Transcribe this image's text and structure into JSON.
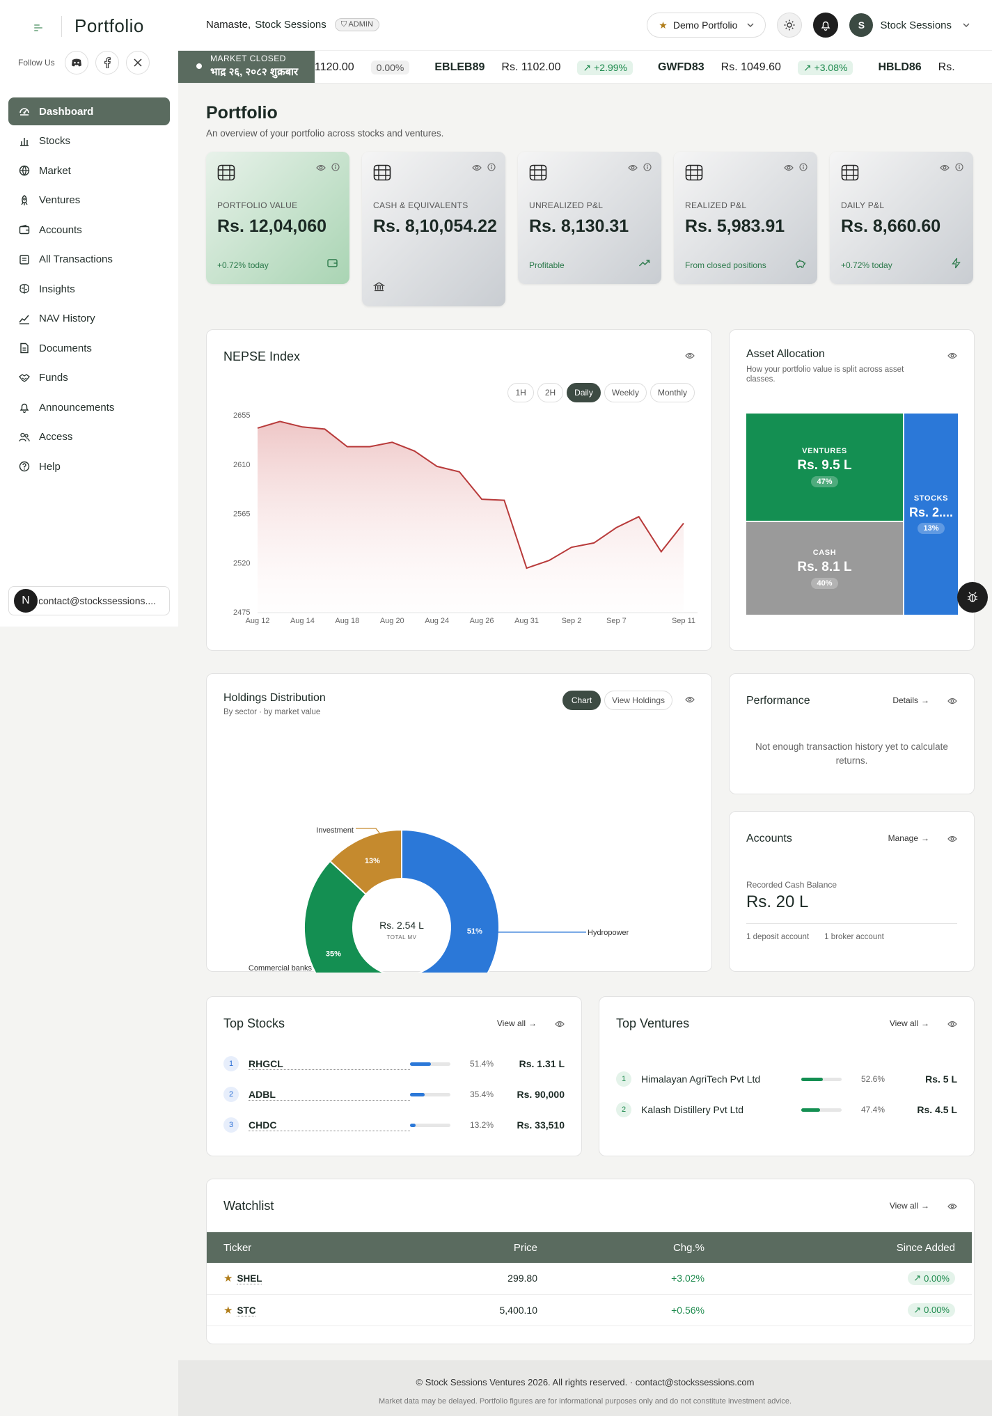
{
  "app": {
    "title": "Portfolio"
  },
  "sidebar": {
    "follow_label": "Follow Us",
    "items": [
      {
        "label": "Dashboard",
        "icon": "dashboard-icon"
      },
      {
        "label": "Stocks",
        "icon": "bar-chart-icon"
      },
      {
        "label": "Market",
        "icon": "globe-icon"
      },
      {
        "label": "Ventures",
        "icon": "rocket-icon"
      },
      {
        "label": "Accounts",
        "icon": "wallet-icon"
      },
      {
        "label": "All Transactions",
        "icon": "receipt-icon"
      },
      {
        "label": "Insights",
        "icon": "brain-icon"
      },
      {
        "label": "NAV History",
        "icon": "line-chart-icon"
      },
      {
        "label": "Documents",
        "icon": "document-icon"
      },
      {
        "label": "Funds",
        "icon": "handshake-icon"
      },
      {
        "label": "Announcements",
        "icon": "bell-icon"
      },
      {
        "label": "Access",
        "icon": "users-icon"
      },
      {
        "label": "Help",
        "icon": "help-icon"
      }
    ],
    "contact_email": "contact@stockssessions....",
    "avatar_letter": "N"
  },
  "topbar": {
    "greeting": "Namaste,",
    "username": "Stock Sessions",
    "role_badge": "ADMIN",
    "portfolio_selector": "Demo Portfolio",
    "user_initial": "S",
    "user_name": "Stock Sessions"
  },
  "ticker": {
    "market_status": "MARKET CLOSED",
    "date_np": "भाद्र २६, २०८२ शुक्रबार",
    "items": [
      {
        "symbol": "",
        "price": "1120.00",
        "change": "0.00%",
        "dir": "neutral"
      },
      {
        "symbol": "EBLEB89",
        "price": "Rs. 1102.00",
        "change": "+2.99%",
        "dir": "up"
      },
      {
        "symbol": "GWFD83",
        "price": "Rs. 1049.60",
        "change": "+3.08%",
        "dir": "up"
      },
      {
        "symbol": "HBLD86",
        "price": "Rs.",
        "change": "",
        "dir": "up"
      }
    ]
  },
  "page": {
    "title": "Portfolio",
    "subtitle": "An overview of your portfolio across stocks and ventures."
  },
  "kpis": [
    {
      "label": "PORTFOLIO VALUE",
      "value": "Rs. 12,04,060",
      "footer": "+0.72% today",
      "variant": "green",
      "icon": "wallet-icon"
    },
    {
      "label": "CASH & EQUIVALENTS",
      "value": "Rs. 8,10,054.22",
      "footer": "",
      "variant": "grey",
      "icon": "bank-icon"
    },
    {
      "label": "UNREALIZED P&L",
      "value": "Rs. 8,130.31",
      "footer": "Profitable",
      "variant": "grey",
      "icon": "trending-up-icon"
    },
    {
      "label": "REALIZED P&L",
      "value": "Rs. 5,983.91",
      "footer": "From closed positions",
      "variant": "grey",
      "icon": "piggy-bank-icon"
    },
    {
      "label": "DAILY P&L",
      "value": "Rs. 8,660.60",
      "footer": "+0.72% today",
      "variant": "grey",
      "icon": "zap-icon"
    }
  ],
  "nepse": {
    "title": "NEPSE Index",
    "ranges": [
      "1H",
      "2H",
      "Daily",
      "Weekly",
      "Monthly"
    ],
    "active_range": "Daily"
  },
  "chart_data": [
    {
      "type": "area",
      "title": "NEPSE Index",
      "x": [
        "Aug 12",
        "Aug 13",
        "Aug 14",
        "Aug 15",
        "Aug 18",
        "Aug 19",
        "Aug 20",
        "Aug 21",
        "Aug 24",
        "Aug 25",
        "Aug 26",
        "Aug 27",
        "Aug 31",
        "Sep 1",
        "Sep 2",
        "Sep 3",
        "Sep 7",
        "Sep 8",
        "Sep 10",
        "Sep 11"
      ],
      "x_tick_labels": [
        "Aug 12",
        "Aug 14",
        "Aug 18",
        "Aug 20",
        "Aug 24",
        "Aug 26",
        "Aug 31",
        "Sep 2",
        "Sep 7",
        "Sep 11"
      ],
      "values": [
        2643,
        2649,
        2644,
        2642,
        2626,
        2626,
        2630,
        2622,
        2608,
        2603,
        2578,
        2577,
        2515,
        2522,
        2534,
        2538,
        2552,
        2562,
        2530,
        2556
      ],
      "ylim": [
        2475,
        2655
      ],
      "yticks": [
        2475,
        2520,
        2565,
        2610,
        2655
      ],
      "color": "#b83a3a",
      "grid": false
    },
    {
      "type": "treemap",
      "title": "Asset Allocation",
      "subtitle": "How your portfolio value is split across asset classes.",
      "segments": [
        {
          "name": "VENTURES",
          "value": "Rs. 9.5 L",
          "percent": 47,
          "color": "#148f52"
        },
        {
          "name": "CASH",
          "value": "Rs. 8.1 L",
          "percent": 40,
          "color": "#9a9a9a"
        },
        {
          "name": "STOCKS",
          "value": "Rs. 2....",
          "percent": 13,
          "color": "#2b78d8"
        }
      ]
    },
    {
      "type": "pie",
      "title": "Holdings Distribution",
      "subtitle": "By sector · by market value",
      "center_value": "Rs. 2.54 L",
      "center_label": "TOTAL MV",
      "slices": [
        {
          "name": "Hydropower",
          "percent": 51,
          "color": "#2b78d8"
        },
        {
          "name": "Commercial banks",
          "percent": 35,
          "color": "#148f52"
        },
        {
          "name": "Investment",
          "percent": 13,
          "color": "#c58a2e"
        }
      ]
    }
  ],
  "holdings": {
    "chart_btn": "Chart",
    "view_btn": "View Holdings"
  },
  "performance": {
    "title": "Performance",
    "details": "Details",
    "empty": "Not enough transaction history yet to calculate returns."
  },
  "accounts": {
    "title": "Accounts",
    "manage": "Manage",
    "label": "Recorded Cash Balance",
    "value": "Rs. 20 L",
    "deposit": "1 deposit account",
    "broker": "1 broker account"
  },
  "top_stocks": {
    "title": "Top Stocks",
    "view_all": "View all",
    "rows": [
      {
        "rank": "1",
        "symbol": "RHGCL",
        "pct": "51.4%",
        "share": 51.4,
        "value": "Rs. 1.31 L"
      },
      {
        "rank": "2",
        "symbol": "ADBL",
        "pct": "35.4%",
        "share": 35.4,
        "value": "Rs. 90,000"
      },
      {
        "rank": "3",
        "symbol": "CHDC",
        "pct": "13.2%",
        "share": 13.2,
        "value": "Rs. 33,510"
      }
    ]
  },
  "top_ventures": {
    "title": "Top Ventures",
    "view_all": "View all",
    "rows": [
      {
        "rank": "1",
        "name": "Himalayan AgriTech Pvt Ltd",
        "pct": "52.6%",
        "share": 52.6,
        "value": "Rs. 5 L"
      },
      {
        "rank": "2",
        "name": "Kalash Distillery Pvt Ltd",
        "pct": "47.4%",
        "share": 47.4,
        "value": "Rs. 4.5 L"
      }
    ]
  },
  "watchlist": {
    "title": "Watchlist",
    "view_all": "View all",
    "columns": [
      "Ticker",
      "Price",
      "Chg.%",
      "Since Added"
    ],
    "rows": [
      {
        "ticker": "SHEL",
        "price": "299.80",
        "chg": "+3.02%",
        "since": "0.00%"
      },
      {
        "ticker": "STC",
        "price": "5,400.10",
        "chg": "+0.56%",
        "since": "0.00%"
      }
    ]
  },
  "footer": {
    "copyright": "© Stock Sessions Ventures 2026. All rights reserved. · contact@stockssessions.com",
    "disclaimer": "Market data may be delayed. Portfolio figures are for informational purposes only and do not constitute investment advice."
  },
  "colors": {
    "accent": "#5a6b5f",
    "positive": "#1d8a4d",
    "negative": "#b83a3a",
    "stocks": "#2b78d8",
    "ventures": "#148f52",
    "cash": "#9a9a9a",
    "investment": "#c58a2e"
  }
}
